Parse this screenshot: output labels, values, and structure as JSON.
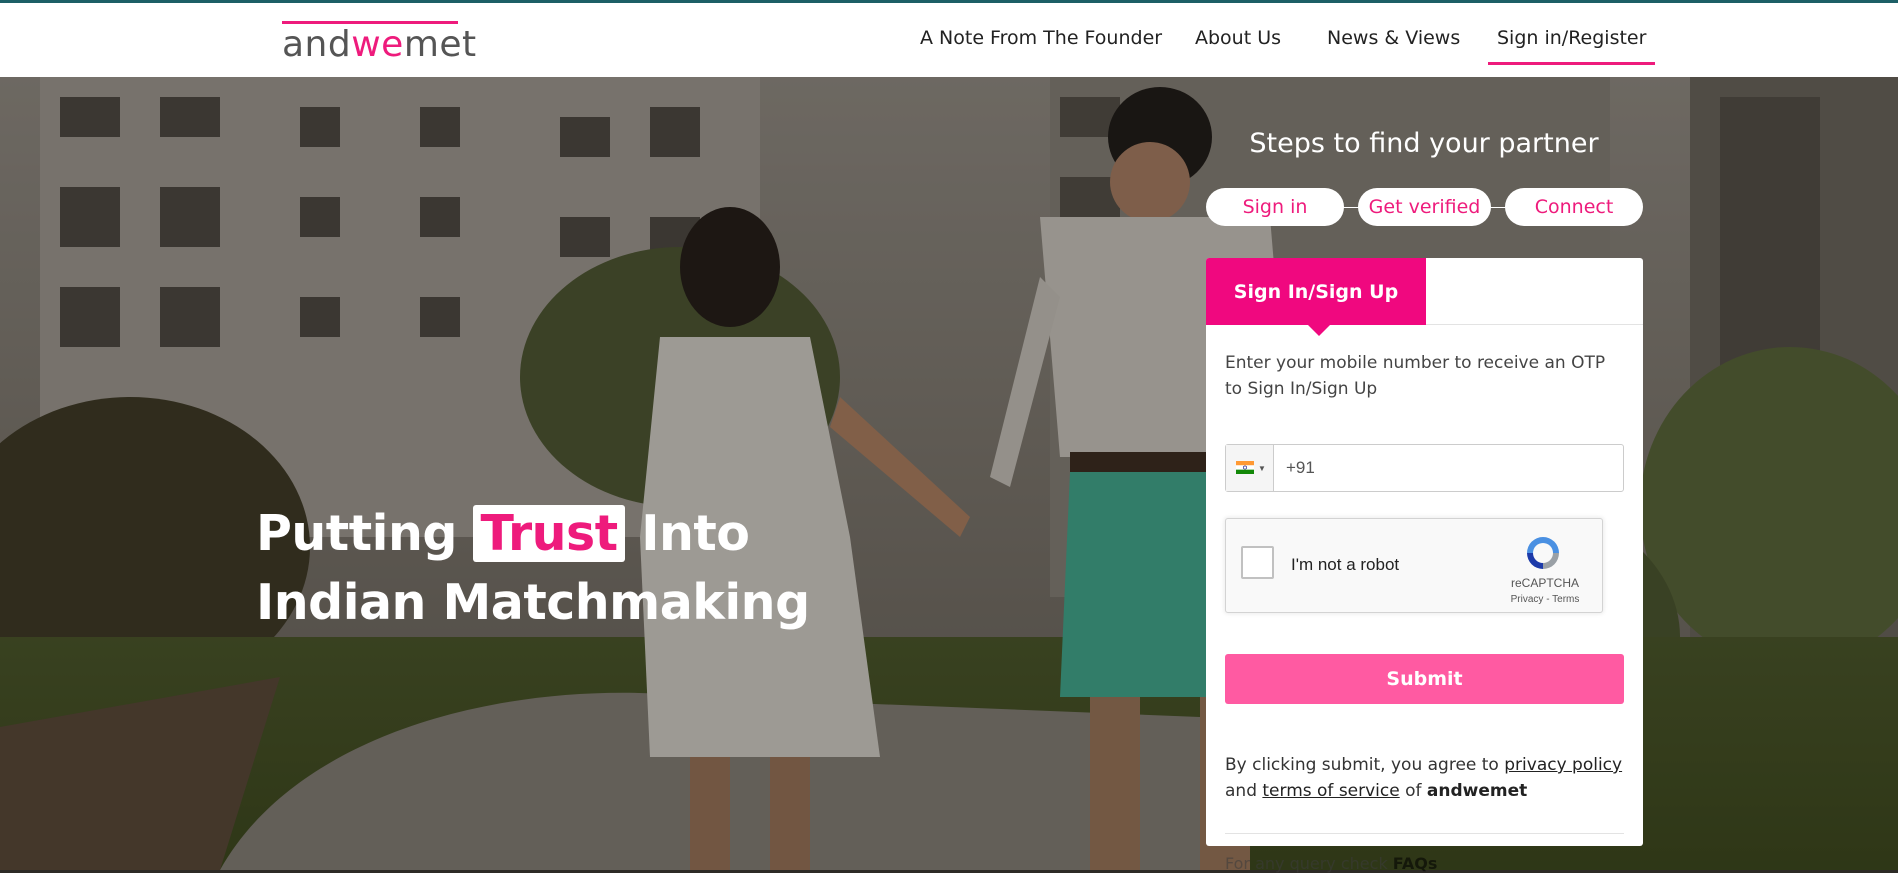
{
  "logo": {
    "prefix": "and",
    "highlight": "we",
    "suffix": "met"
  },
  "nav": {
    "items": [
      {
        "label": "A Note From The Founder"
      },
      {
        "label": "About Us"
      },
      {
        "label": "News & Views"
      },
      {
        "label": "Sign in/Register",
        "active": true
      }
    ]
  },
  "hero": {
    "headline_part1": "Putting ",
    "headline_highlight": "Trust",
    "headline_part2": " Into",
    "headline_line2": "Indian Matchmaking"
  },
  "steps": {
    "title": "Steps to find your partner",
    "items": [
      "Sign in",
      "Get verified",
      "Connect"
    ]
  },
  "signin": {
    "tab_label": "Sign In/Sign Up",
    "instructions": "Enter your mobile number to receive an OTP to Sign In/Sign Up",
    "phone": {
      "country_flag": "india-flag-icon",
      "placeholder": "+91",
      "value": ""
    },
    "captcha": {
      "label": "I'm not a robot",
      "brand": "reCAPTCHA",
      "links": "Privacy - Terms"
    },
    "submit_label": "Submit",
    "terms_prefix": "By clicking submit, you agree to ",
    "privacy_link": "privacy policy",
    "terms_and": "and ",
    "terms_link": "terms of service",
    "terms_of": " of ",
    "brand": "andwemet",
    "faq_prefix": "For any query check ",
    "faq_link": "FAQs"
  },
  "colors": {
    "brand_pink": "#ee1b7c",
    "submit_pink": "#ff5aa2",
    "header_rule": "#1d5f66"
  }
}
